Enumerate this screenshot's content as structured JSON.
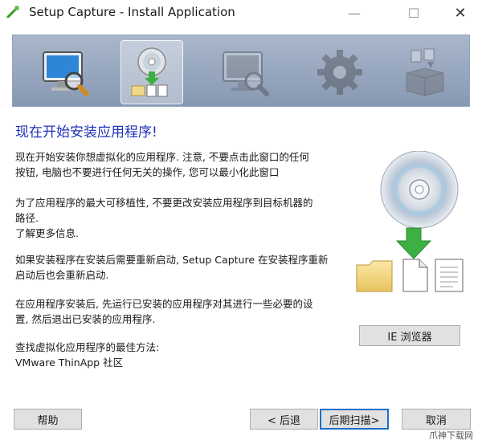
{
  "window": {
    "title": "Setup Capture - Install Application",
    "minimize_glyph": "—",
    "maximize_glyph": "☐",
    "close_glyph": "✕"
  },
  "banner": {
    "steps": [
      {
        "icon": "monitor-magnifier-icon",
        "state": "done"
      },
      {
        "icon": "cd-install-icon",
        "state": "active"
      },
      {
        "icon": "monitor-magnifier-icon",
        "state": "pending"
      },
      {
        "icon": "gear-icon",
        "state": "pending"
      },
      {
        "icon": "package-icon",
        "state": "pending"
      }
    ]
  },
  "content": {
    "heading": "现在开始安装应用程序!",
    "para1": [
      "现在开始安装你想虚拟化的应用程序. 注意, 不要点击此窗口的任何",
      "按钮, 电脑也不要进行任何无关的操作, 您可以最小化此窗口"
    ],
    "para2": [
      "为了应用程序的最大可移植性, 不要更改安装应用程序到目标机器的",
      "路径."
    ],
    "learn_more": "了解更多信息.",
    "para3": [
      "如果安装程序在安装后需要重新启动, Setup Capture 在安装程序重新",
      "启动后也会重新启动."
    ],
    "para4": [
      "在应用程序安装后, 先运行已安装的应用程序对其进行一些必要的设",
      "置, 然后退出已安装的应用程序."
    ],
    "para5": [
      "查找虚拟化应用程序的最佳方法:",
      "VMware ThinApp 社区"
    ]
  },
  "buttons": {
    "ie": "IE 浏览器",
    "help": "帮助",
    "back": "< 后退",
    "next": "后期扫描>",
    "cancel": "取消"
  },
  "watermark": "爪神下载网",
  "colors": {
    "heading": "#1f33b8",
    "banner": "#8f9fb8",
    "focus": "#1c6fc9"
  }
}
